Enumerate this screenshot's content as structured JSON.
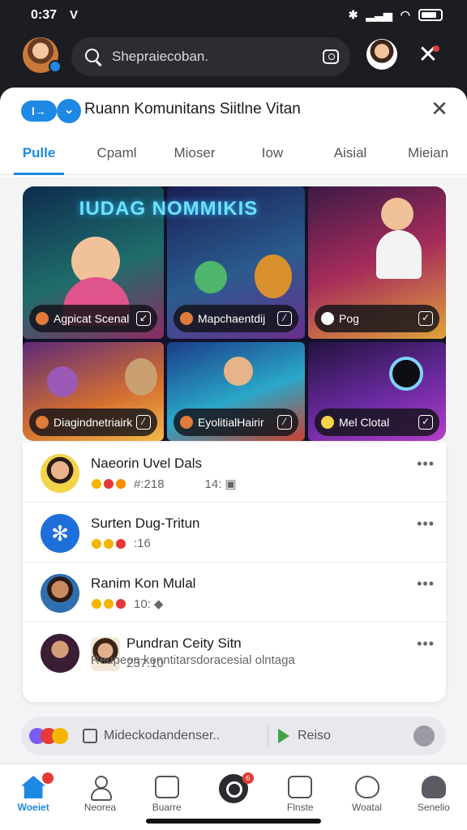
{
  "status": {
    "time": "0:37",
    "time_icon": "V"
  },
  "search": {
    "text": "Shepraiecoban."
  },
  "sheet": {
    "title": "Ruann Komunitans Siitlne Vitan",
    "logo_text": "I→"
  },
  "tabs": [
    "Pulle",
    "Cpaml",
    "Mioser",
    "Iow",
    "Aisial",
    "Mieian"
  ],
  "banner": {
    "title": "IUDAG NOMMIKIS",
    "tiles": [
      {
        "label": "Agpicat Scenal",
        "check": "↙"
      },
      {
        "label": "Mapchaentdij",
        "check": "⁄"
      },
      {
        "label": "Pog",
        "check": "✓"
      },
      {
        "label": "Diagindnetriairk",
        "check": "⁄"
      },
      {
        "label": "EyolitialHairir",
        "check": "⁄"
      },
      {
        "label": "Mel Clotal",
        "check": "✓"
      }
    ]
  },
  "list": [
    {
      "name": "Naeorin Uvel Dals",
      "meta1": "#:218",
      "meta2": "14:"
    },
    {
      "name": "Surten Dug-Tritun",
      "meta1": ":16",
      "meta2": ""
    },
    {
      "name": "Ranim Kon Mulal",
      "meta1": "10:",
      "meta2": ""
    },
    {
      "name": "Pundran Ceity Sitn",
      "meta1": "237.10",
      "meta2": ""
    }
  ],
  "list_sub": "Reupeon konntitarsdoracesial olntaga",
  "composer": {
    "text": "Mideckodandenser..",
    "right": "Reiso"
  },
  "nav": [
    {
      "label": "Woeiet",
      "badge": ""
    },
    {
      "label": "Neorea",
      "badge": ""
    },
    {
      "label": "Buarre",
      "badge": ""
    },
    {
      "label": "",
      "badge": "6"
    },
    {
      "label": "Flnste",
      "badge": ""
    },
    {
      "label": "Woatal",
      "badge": ""
    },
    {
      "label": "Senelio",
      "badge": ""
    }
  ]
}
